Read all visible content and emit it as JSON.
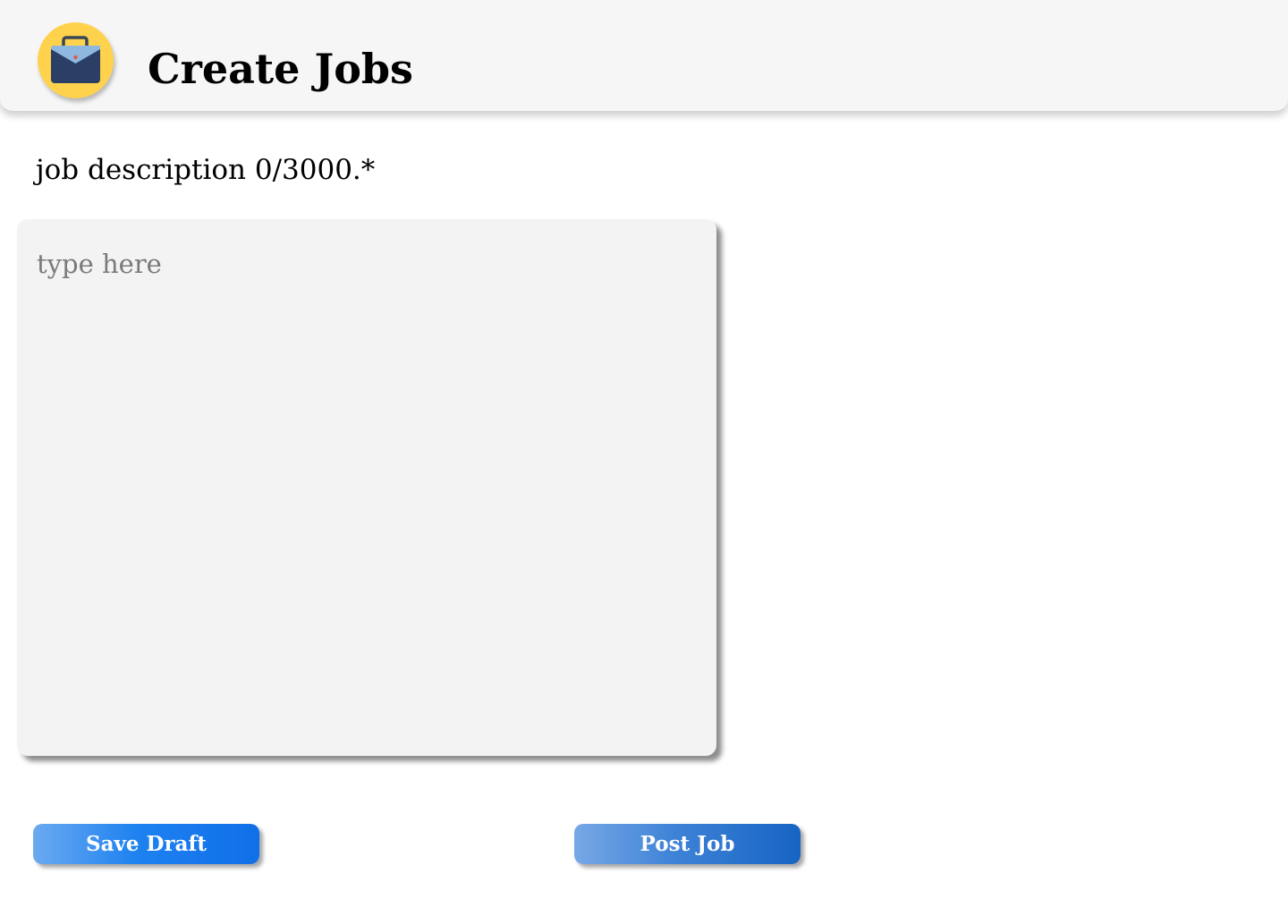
{
  "header": {
    "title": "Create Jobs",
    "logo_icon": "briefcase-icon",
    "logo_bg_color": "#ffd24d"
  },
  "form": {
    "description_label": "job description 0/3000.*",
    "description_placeholder": "type here",
    "description_value": ""
  },
  "actions": {
    "save_label": "Save Draft",
    "post_label": "Post Job"
  },
  "colors": {
    "header_bg": "#f6f6f6",
    "textarea_bg": "#f3f3f3",
    "save_accent": "#1f82f0",
    "post_accent": "#1764c4"
  }
}
